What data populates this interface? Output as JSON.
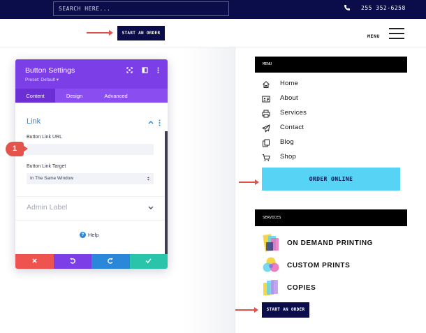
{
  "topbar": {
    "search_placeholder": "SEARCH HERE...",
    "phone_icon": "phone-icon",
    "phone": "255 352-6258"
  },
  "header": {
    "cta_label": "START AN ORDER",
    "menu_label": "MENU",
    "hamburger_icon": "hamburger-icon"
  },
  "panel": {
    "title": "Button Settings",
    "preset": "Preset: Default ▾",
    "tabs": [
      "Content",
      "Design",
      "Advanced"
    ],
    "active_tab": "Content",
    "section_title": "Link",
    "url_label": "Button Link URL",
    "url_value": "",
    "target_label": "Button Link Target",
    "target_value": "In The Same Window",
    "admin_label": "Admin Label",
    "help_label": "Help",
    "accent": "#7c3ee6"
  },
  "badge": "1",
  "sidebar": {
    "menu_heading": "MENU",
    "menu_items": [
      {
        "label": "Home",
        "icon": "home-icon"
      },
      {
        "label": "About",
        "icon": "id-card-icon"
      },
      {
        "label": "Services",
        "icon": "printer-icon"
      },
      {
        "label": "Contact",
        "icon": "paper-plane-icon"
      },
      {
        "label": "Blog",
        "icon": "documents-icon"
      },
      {
        "label": "Shop",
        "icon": "cart-icon"
      }
    ],
    "order_online": "ORDER ONLINE",
    "services_heading": "SERVICES",
    "services": [
      {
        "label": "ON DEMAND PRINTING",
        "icon": "printing-icon"
      },
      {
        "label": "CUSTOM PRINTS",
        "icon": "custom-prints-icon"
      },
      {
        "label": "COPIES",
        "icon": "copies-icon"
      }
    ],
    "start_order": "START AN ORDER"
  },
  "colors": {
    "navy": "#0b0d4a",
    "cyan": "#57d3f5",
    "red_arrow": "#e0514b",
    "discard": "#ef5350",
    "undo": "#7c3ee6",
    "redo": "#2b87da",
    "save": "#29c4a9"
  }
}
